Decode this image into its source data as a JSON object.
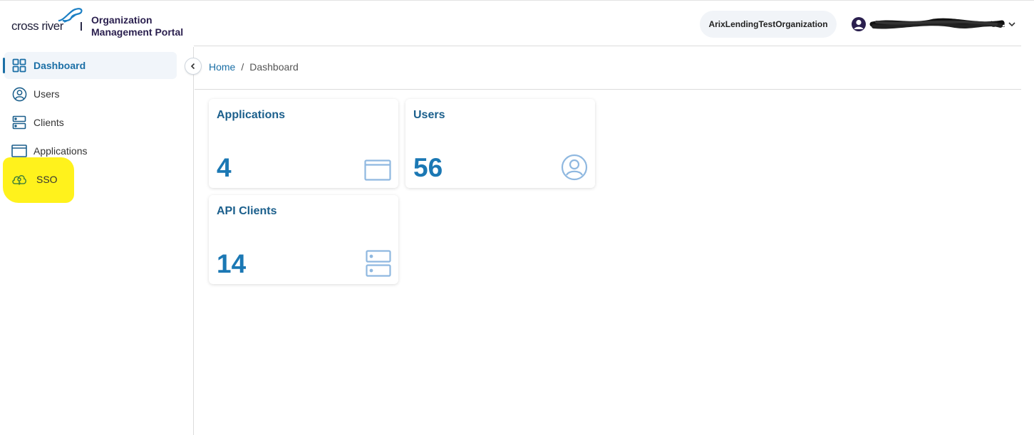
{
  "header": {
    "logo_text": "cross river",
    "portal_title_line1": "Organization",
    "portal_title_line2": "Management Portal",
    "organization": "ArixLendingTestOrganization",
    "user_name": "User"
  },
  "sidebar": {
    "items": [
      {
        "label": "Dashboard",
        "icon": "grid-icon",
        "active": true
      },
      {
        "label": "Users",
        "icon": "user-circle-icon"
      },
      {
        "label": "Clients",
        "icon": "server-icon"
      },
      {
        "label": "Applications",
        "icon": "window-icon"
      },
      {
        "label": "SSO",
        "icon": "cloud-key-icon"
      }
    ]
  },
  "breadcrumb": {
    "home": "Home",
    "separator": "/",
    "current": "Dashboard"
  },
  "cards": [
    {
      "title": "Applications",
      "value": "4",
      "icon": "window-icon"
    },
    {
      "title": "Users",
      "value": "56",
      "icon": "user-circle-icon"
    },
    {
      "title": "API Clients",
      "value": "14",
      "icon": "server-icon"
    }
  ],
  "colors": {
    "accent": "#1b6fa6",
    "card_value": "#1b78b4",
    "card_icon": "#8fb8e0",
    "highlight": "#fff21c"
  }
}
